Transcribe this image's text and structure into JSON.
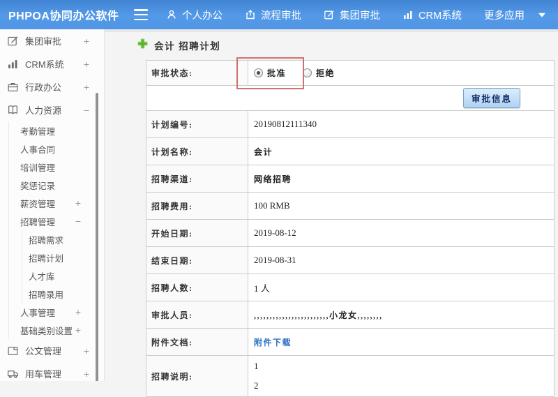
{
  "header": {
    "logo": "PHPOA协同办公软件",
    "nav": [
      {
        "label": "个人办公",
        "icon": "person-icon"
      },
      {
        "label": "流程审批",
        "icon": "workflow-icon"
      },
      {
        "label": "集团审批",
        "icon": "edit-square-icon"
      },
      {
        "label": "CRM系统",
        "icon": "bar-chart-icon"
      },
      {
        "label": "更多应用",
        "icon": "caret-down-icon"
      }
    ]
  },
  "sidebar": {
    "items": [
      {
        "label": "集团审批",
        "toggle": "+",
        "icon": "edit-square-icon"
      },
      {
        "label": "CRM系统",
        "toggle": "+",
        "icon": "bar-chart-icon"
      },
      {
        "label": "行政办公",
        "toggle": "+",
        "icon": "briefcase-icon"
      },
      {
        "label": "人力资源",
        "toggle": "−",
        "icon": "book-icon"
      },
      {
        "label": "考勤管理"
      },
      {
        "label": "人事合同"
      },
      {
        "label": "培训管理"
      },
      {
        "label": "奖惩记录"
      },
      {
        "label": "薪资管理",
        "toggle": "+"
      },
      {
        "label": "招聘管理",
        "toggle": "−"
      },
      {
        "label": "招聘需求"
      },
      {
        "label": "招聘计划"
      },
      {
        "label": "人才库"
      },
      {
        "label": "招聘录用"
      },
      {
        "label": "人事管理",
        "toggle": "+"
      },
      {
        "label": "基础类别设置",
        "toggle": "+"
      },
      {
        "label": "公文管理",
        "toggle": "+",
        "icon": "document-icon"
      },
      {
        "label": "用车管理",
        "toggle": "+",
        "icon": "truck-icon"
      }
    ]
  },
  "main": {
    "title": "会计 招聘计划",
    "approval": {
      "label": "审批状态:",
      "options": [
        "批准",
        "拒绝"
      ],
      "selected": "批准"
    },
    "approval_info_button": "审批信息",
    "rows": [
      {
        "label": "计划编号:",
        "value": "20190812111340"
      },
      {
        "label": "计划名称:",
        "value": "会计"
      },
      {
        "label": "招聘渠道:",
        "value": "网络招聘"
      },
      {
        "label": "招聘费用:",
        "value": "100 RMB"
      },
      {
        "label": "开始日期:",
        "value": "2019-08-12"
      },
      {
        "label": "结束日期:",
        "value": "2019-08-31"
      },
      {
        "label": "招聘人数:",
        "value": "1 人"
      },
      {
        "label": "审批人员:",
        "value": ",,,,,,,,,,,,,,,,,,,,,,,,小龙女,,,,,,,,"
      },
      {
        "label": "附件文档:",
        "value": "附件下载"
      },
      {
        "label": "招聘说明:",
        "lines": [
          "1",
          "2"
        ]
      }
    ]
  },
  "colors": {
    "header_blue": "#4f95e3",
    "annotation_red": "#d07070",
    "link_blue": "#2c6fc4",
    "plus_green": "#5cb52e",
    "button_text_navy": "#14306a"
  }
}
